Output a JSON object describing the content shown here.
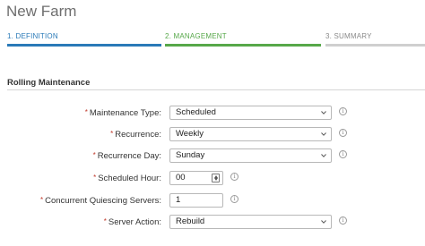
{
  "window": {
    "title": "New Farm"
  },
  "steps": [
    {
      "label": "1. DEFINITION",
      "state": "complete",
      "color": "#2a7ab8"
    },
    {
      "label": "2. MANAGEMENT",
      "state": "active",
      "color": "#57a84a"
    },
    {
      "label": "3. SUMMARY",
      "state": "pending",
      "color": "#cfcfcf"
    }
  ],
  "section": {
    "title": "Rolling Maintenance"
  },
  "fields": {
    "required_marker": "*",
    "maintenance_type": {
      "label": "Maintenance Type:",
      "value": "Scheduled",
      "icon": "chevron-down-icon"
    },
    "recurrence": {
      "label": "Recurrence:",
      "value": "Weekly",
      "icon": "chevron-down-icon"
    },
    "recurrence_day": {
      "label": "Recurrence Day:",
      "value": "Sunday",
      "icon": "chevron-down-icon"
    },
    "scheduled_hour": {
      "label": "Scheduled Hour:",
      "value": "00",
      "icon": "spinner-icon"
    },
    "quiescing_servers": {
      "label": "Concurrent Quiescing Servers:",
      "value": "1"
    },
    "server_action": {
      "label": "Server Action:",
      "value": "Rebuild",
      "icon": "chevron-down-icon"
    }
  },
  "info_icon": "info-icon"
}
